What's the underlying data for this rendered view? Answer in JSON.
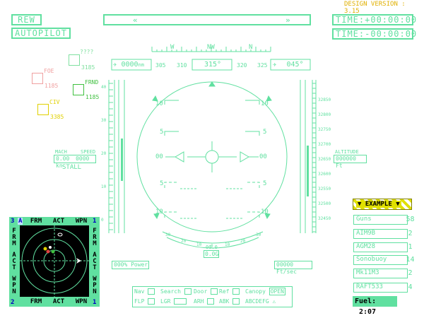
{
  "design_version": "DESIGN VERSION : 3.15",
  "buttons": {
    "rew": "REW",
    "autopilot": "AUTOPILOT"
  },
  "top_bar": {
    "left_arrow": "«",
    "right_arrow": "»"
  },
  "timers": {
    "time_plus": "TIME:+00:00:00",
    "time_minus": "TIME:-00:00:00"
  },
  "compass": {
    "labels": [
      "W",
      "NW",
      "N"
    ],
    "range_value": "0000",
    "range_unit": "nm",
    "ticks": [
      "305",
      "310",
      "315°",
      "320",
      "325"
    ],
    "bearing": "045°"
  },
  "contacts": [
    {
      "label": "????",
      "value": "3185",
      "color": "#80e0a0"
    },
    {
      "label": "FOE",
      "value": "1185",
      "color": "#f0a0a0"
    },
    {
      "label": "FRND",
      "value": "1185",
      "color": "#40c040"
    },
    {
      "label": "CIV",
      "value": "3385",
      "color": "#e0d000"
    }
  ],
  "airspeed": {
    "mach_label": "MACH",
    "speed_label": "SPEED",
    "mach": "0.00",
    "speed": "0000",
    "unit": "kn",
    "stall": "STALL"
  },
  "altitude": {
    "label": "ALTITUDE",
    "value": "000000",
    "unit": "Ft"
  },
  "pitch_ladder": {
    "labels": [
      "10",
      "5",
      "00",
      "5",
      "10"
    ]
  },
  "alt_ticks": [
    "32850",
    "32800",
    "32750",
    "32700",
    "32650",
    "32600",
    "32550",
    "32500",
    "32450"
  ],
  "speed_ticks": [
    "40",
    "30",
    "20",
    "10",
    "0"
  ],
  "bank_scale": [
    "30",
    "20",
    "10",
    "0",
    "10",
    "20",
    "30"
  ],
  "g_load": {
    "top": "00.0",
    "bottom": "0.0",
    "unit": "G"
  },
  "power": {
    "value": "000",
    "unit": "%",
    "label": "Power"
  },
  "vsi": {
    "value": "00000",
    "unit": "Ft/sec"
  },
  "status_panel": {
    "row1": [
      {
        "label": "Nav"
      },
      {
        "label": "Search"
      },
      {
        "label": "Door"
      },
      {
        "label": "Ref"
      },
      {
        "label": "Canopy",
        "value": "OPEN"
      }
    ],
    "row2": [
      {
        "label": "FLP"
      },
      {
        "label": "LGR"
      },
      {
        "label": "ARH"
      },
      {
        "label": "ABK"
      },
      {
        "label": "ABCDEFG"
      }
    ]
  },
  "radar": {
    "mode_left_top": "3",
    "mode_a": "A",
    "mode_right_top": "1",
    "mode_left_bottom": "2",
    "mode_right_bottom": "1",
    "top_tabs": [
      "FRM",
      "ACT",
      "WPN"
    ],
    "bottom_tabs": [
      "FRM",
      "ACT",
      "WPN"
    ],
    "side_left": [
      "FRM",
      "ACT",
      "WPN"
    ],
    "side_right": [
      "FRM",
      "ACT",
      "WPN"
    ]
  },
  "weapons": {
    "header": "EXAMPLE",
    "items": [
      {
        "name": "Guns",
        "count": "58"
      },
      {
        "name": "AIM9B",
        "count": "2"
      },
      {
        "name": "AGM28",
        "count": "1"
      },
      {
        "name": "Sonobuoy",
        "count": "14"
      },
      {
        "name": "Mk11M3",
        "count": "2"
      },
      {
        "name": "RAFT533",
        "count": "4"
      }
    ],
    "fuel_label": "Fuel:",
    "fuel_value": "2:07"
  },
  "colors": {
    "hud": "#60e0a0",
    "foe": "#f0a0a0",
    "friend": "#40c040",
    "civ": "#e0d000",
    "version": "#e0b000"
  }
}
